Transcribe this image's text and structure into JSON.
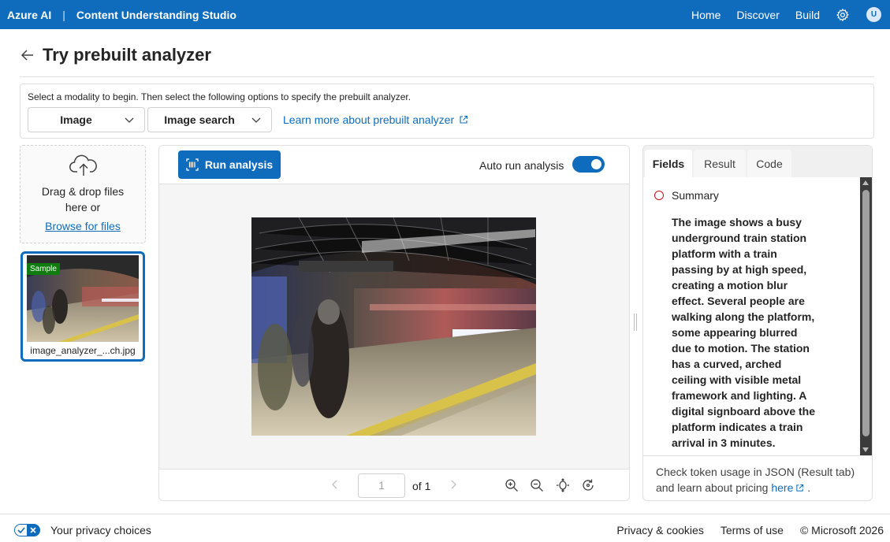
{
  "topbar": {
    "brand": "Azure AI",
    "separator": "|",
    "app_name": "Content Understanding Studio",
    "nav": [
      "Home",
      "Discover",
      "Build"
    ],
    "avatar_initial": "U"
  },
  "header": {
    "title": "Try prebuilt analyzer"
  },
  "options": {
    "hint": "Select a modality to begin. Then select the following options to specify the prebuilt analyzer.",
    "modality": "Image",
    "analyzer": "Image search",
    "learn_more": "Learn more about prebuilt analyzer"
  },
  "upload": {
    "drag_line1": "Drag & drop files",
    "drag_line2": "here or",
    "browse": "Browse for files"
  },
  "thumbnail": {
    "badge": "Sample",
    "filename": "image_analyzer_...ch.jpg"
  },
  "center": {
    "run_label": "Run analysis",
    "auto_run_label": "Auto run analysis",
    "auto_run_on": true,
    "page_input": "1",
    "page_of": "of 1"
  },
  "right": {
    "tabs": [
      "Fields",
      "Result",
      "Code"
    ],
    "active_tab": "Fields",
    "field_label": "Summary",
    "summary": "The image shows a busy underground train station platform with a train passing by at high speed, creating a motion blur effect. Several people are walking along the platform, some appearing blurred due to motion. The station has a curved, arched ceiling with visible metal framework and lighting. A digital signboard above the platform indicates a train arrival in 3 minutes.",
    "token_text": "Check token usage in JSON (Result tab) and learn about pricing",
    "token_link": "here",
    "token_end": "."
  },
  "footer": {
    "privacy": "Your privacy choices",
    "links": [
      "Privacy & cookies",
      "Terms of use",
      "© Microsoft 2026"
    ]
  },
  "colors": {
    "brand": "#0f6cbd",
    "sample_badge": "#107c10",
    "field_ring": "#c50f1f"
  },
  "icons": [
    "settings-gear-icon",
    "arrow-left-icon",
    "chevron-down-icon",
    "external-link-icon",
    "cloud-upload-icon",
    "scan-icon",
    "zoom-in-icon",
    "zoom-out-icon",
    "fit-icon",
    "rotate-icon",
    "privacy-toggle-icon"
  ]
}
